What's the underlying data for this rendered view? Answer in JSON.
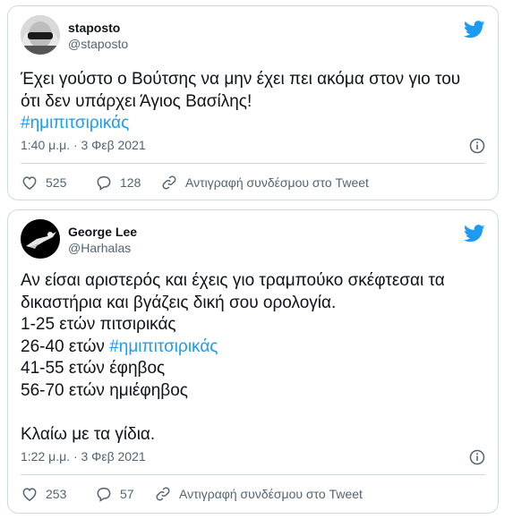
{
  "tweets": [
    {
      "display_name": "staposto",
      "handle": "@staposto",
      "line1": "Έχει γούστο ο Βούτσης να μην έχει πει ακόμα στον γιο του",
      "line2": "ότι δεν υπάρχει Άγιος Βασίλης!",
      "hashtag": "#ημιπιτσιρικάς",
      "timestamp": "1:40 μ.μ. · 3 Φεβ 2021",
      "likes": "525",
      "replies": "128",
      "copy_link": "Αντιγραφή συνδέσμου στο Tweet"
    },
    {
      "display_name": "George Lee",
      "handle": "@Harhalas",
      "line1": "Αν είσαι αριστερός και έχεις γιο τραμπούκο σκέφτεσαι τα",
      "line2": "δικαστήρια και βγάζεις δική σου ορολογία.",
      "line3": "1-25 ετών πιτσιρικάς",
      "line4_prefix": "26-40 ετών ",
      "line4_hashtag": "#ημιπιτσιρικάς",
      "line5": "41-55 ετών έφηβος",
      "line6": "56-70 ετών ημιέφηβος",
      "line7": "Κλαίω με τα γίδια.",
      "timestamp": "1:22 μ.μ. · 3 Φεβ 2021",
      "likes": "253",
      "replies": "57",
      "copy_link": "Αντιγραφή συνδέσμου στο Tweet"
    }
  ],
  "colors": {
    "accent": "#1d9bf0",
    "text": "#0f1419",
    "muted": "#536471",
    "border": "#cfd9de"
  },
  "icons": [
    "twitter-bird-icon",
    "info-icon",
    "heart-icon",
    "reply-icon",
    "link-icon"
  ]
}
